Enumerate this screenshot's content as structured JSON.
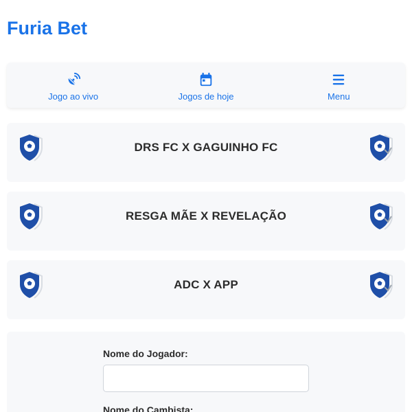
{
  "app": {
    "title": "Furia Bet"
  },
  "nav": {
    "items": [
      {
        "label": "Jogo ao vivo",
        "icon": "satellite-dish-icon"
      },
      {
        "label": "Jogos de hoje",
        "icon": "calendar-icon"
      },
      {
        "label": "Menu",
        "icon": "hamburger-menu-icon"
      }
    ]
  },
  "matches": [
    {
      "title": "DRS FC X GAGUINHO FC"
    },
    {
      "title": "RESGA MÃE X REVELAÇÃO"
    },
    {
      "title": "ADC X APP"
    }
  ],
  "form": {
    "player_label": "Nome do Jogador:",
    "player_value": "",
    "bookie_label": "Nome do Cambista:"
  },
  "colors": {
    "accent": "#1a73e8",
    "shield": "#1f4fa8"
  }
}
